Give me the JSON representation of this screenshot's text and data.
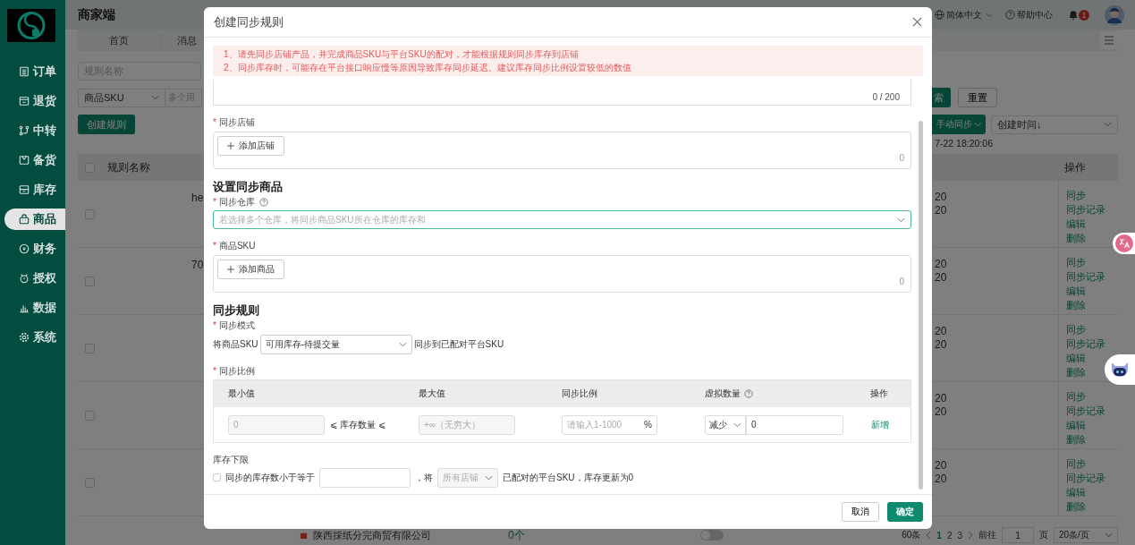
{
  "sidebar": {
    "items": [
      {
        "label": "订单",
        "selected": false
      },
      {
        "label": "退货",
        "selected": false
      },
      {
        "label": "中转",
        "selected": false
      },
      {
        "label": "备货",
        "selected": false
      },
      {
        "label": "库存",
        "selected": false
      },
      {
        "label": "商品",
        "selected": true
      },
      {
        "label": "财务",
        "selected": false
      },
      {
        "label": "授权",
        "selected": false
      },
      {
        "label": "数据",
        "selected": false
      },
      {
        "label": "系统",
        "selected": false
      }
    ]
  },
  "header": {
    "title": "商家端",
    "language": "简体中文",
    "help": "帮助中心",
    "notifications": "1"
  },
  "tabs": [
    "首页",
    "消息"
  ],
  "filters": {
    "rule_name_placeholder": "规则名称",
    "sku_type": "商品SKU",
    "sku_placeholder": "多个用",
    "search": "索",
    "reset": "重置",
    "create": "创建规则",
    "sync": "手动同步",
    "sort": "创建时间↓",
    "timestamp": "7-22 18:20:06"
  },
  "table": {
    "columns": [
      "规则名称",
      "操作"
    ],
    "all_checked": false,
    "rows": [
      {
        "checked": false,
        "fragment": "he",
        "times": [
          "20",
          "20"
        ],
        "actions": [
          "同步",
          "同步记录",
          "编辑",
          "删除"
        ]
      },
      {
        "checked": false,
        "fragment": "70",
        "times": [
          "20",
          "20"
        ],
        "actions": [
          "同步",
          "同步记录",
          "编辑",
          "删除"
        ]
      },
      {
        "checked": false,
        "times": [
          "20",
          "20"
        ],
        "actions": [
          "同步",
          "同步记录",
          "编辑",
          "删除"
        ]
      },
      {
        "checked": false,
        "times": [
          "20",
          "20"
        ],
        "actions": [
          "同步",
          "同步记录",
          "编辑",
          "删除"
        ]
      },
      {
        "checked": false,
        "times": [
          "20",
          "20"
        ],
        "actions": [
          "同步",
          "同步记录",
          "编辑",
          "删除"
        ]
      }
    ],
    "last_row": {
      "company": "陕西採纸分完商贸有限公司",
      "count": "0个",
      "on": false
    }
  },
  "pagination": {
    "total": "60条",
    "pages": [
      {
        "label": "1",
        "selected": true
      },
      {
        "label": "2",
        "selected": false
      },
      {
        "label": "3",
        "selected": false
      }
    ],
    "goto": "前往",
    "page": "1",
    "page_unit": "页",
    "page_size": "20条/页"
  },
  "dialog": {
    "title": "创建同步规则",
    "notices": [
      "1、请先同步店铺产品，并完成商品SKU与平台SKU的配对，才能根据规则同步库存到店铺",
      "2、同步库存时，可能存在平台接口响应慢等原因导致库存同步延迟。建议库存同步比例设置较低的数值"
    ],
    "remark_counter": "0 / 200",
    "store": {
      "mark": "*",
      "label": "同步店铺",
      "add": "添加店铺",
      "count": "0"
    },
    "section_goods": "设置同步商品",
    "warehouse": {
      "mark": "*",
      "label": "同步仓库",
      "placeholder": "若选择多个仓库，将同步商品SKU所在仓库的库存和"
    },
    "sku": {
      "mark": "*",
      "label": "商品SKU",
      "add": "添加商品",
      "count": "0"
    },
    "section_rules": "同步规则",
    "mode": {
      "mark": "*",
      "label": "同步模式",
      "prefix": "将商品SKU",
      "value": "可用库存-待提交量",
      "suffix": "同步到已配对平台SKU"
    },
    "ratio": {
      "mark": "*",
      "label": "同步比例",
      "columns": [
        "最小值",
        "最大值",
        "同步比例",
        "虚拟数量",
        "操作"
      ],
      "rows": [
        {
          "min": "0",
          "between": "⩽ 库存数量 ⩽",
          "max": "+∞（无穷大）",
          "ratio_placeholder": "请输入1-1000",
          "unit": "%",
          "adjust": "减少",
          "virtual": "0",
          "action": "新增"
        }
      ]
    },
    "floor": {
      "label": "库存下限",
      "checked": false,
      "text1": "同步的库存数小于等于",
      "text2": "，将",
      "store_placeholder": "所有店铺",
      "text3": "已配对的平台SKU，库存更新为0"
    },
    "cancel": "取消",
    "confirm": "确定"
  }
}
